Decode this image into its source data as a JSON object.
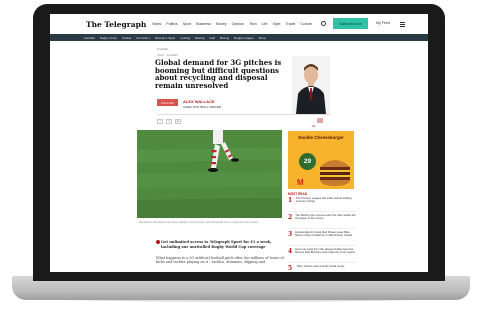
{
  "site": {
    "logo": "The Telegraph",
    "top_nav": [
      "News",
      "Politics",
      "Sport",
      "Business",
      "Money",
      "Opinion",
      "Tech",
      "Life",
      "Style",
      "Travel",
      "Culture"
    ],
    "subscribe_label": "Subscribe now",
    "myfeed_label": "My Feed"
  },
  "sub_nav": [
    "Football",
    "Rugby Union",
    "Cricket",
    "Formula 1",
    "Women's Sport",
    "Cycling",
    "Racing",
    "Golf",
    "Boxing",
    "Rugby League",
    "More"
  ],
  "article": {
    "breadcrumb": "Football",
    "meta": "Sport · Football",
    "headline": "Global demand for 3G pitches is booming but difficult questions about recycling and disposal remain unresolved",
    "follow_label": "FOLLOW",
    "author_name": "ALEX WALLACE",
    "author_role": "CHIEF FOOTBALL WRITER",
    "comment_count": "40",
    "share_icons": [
      "f",
      "t",
      "in"
    ],
    "caption": "Demand for 3G pitches has grown rapidly in recent years, with thousands now in use across the country",
    "promo_text": "Get unlimited access to Telegraph Sport for £1 a week, including our unrivalled Rugby World Cup coverage",
    "body_text": "What happens to a 3G artificial football pitch after the millions of hours of kicks and tackles playing on it – tackles, dummies, slipping and"
  },
  "ad": {
    "title": "Double Cheeseburger",
    "price": "29",
    "logo": "M"
  },
  "most_read": {
    "title": "MOST READ",
    "items": [
      {
        "num": "1",
        "text": "The Premier League will mark storied striking summer rulings"
      },
      {
        "num": "2",
        "text": "The Welsh prop comes under fire after tackle left his player in the victory"
      },
      {
        "num": "3",
        "text": "How England's rising Red Roses upset Blue Moons draw confidence in Manchester United"
      },
      {
        "num": "4",
        "text": "How one word from the players finally keep the Recent Red Bull fans and made the crew rejoice"
      },
      {
        "num": "5",
        "text": "Why Joanne was at least would sense"
      }
    ]
  },
  "colors": {
    "accent": "#b31b1b",
    "subscribe": "#2fc2a6",
    "subnav": "#2a3b46",
    "ad_background": "#f7b32b"
  }
}
